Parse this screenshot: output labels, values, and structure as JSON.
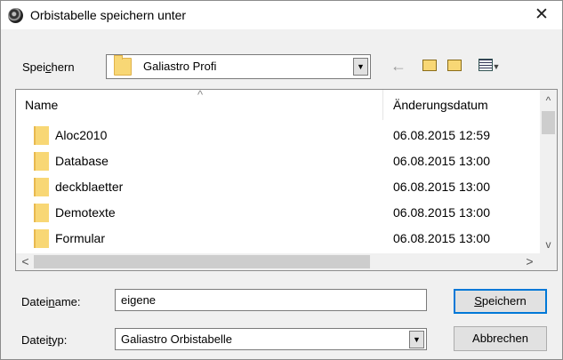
{
  "window": {
    "title": "Orbistabelle speichern unter",
    "close_label": "✕"
  },
  "savein": {
    "label_pre": "Spei",
    "label_u": "c",
    "label_post": "hern",
    "value": "Galiastro Profi"
  },
  "toolbar": {
    "back": "←"
  },
  "list": {
    "headers": {
      "name": "Name",
      "date": "Änderungsdatum",
      "sort_caret": "^"
    },
    "rows": [
      {
        "name": "Aloc2010",
        "date": "06.08.2015 12:59"
      },
      {
        "name": "Database",
        "date": "06.08.2015 13:00"
      },
      {
        "name": "deckblaetter",
        "date": "06.08.2015 13:00"
      },
      {
        "name": "Demotexte",
        "date": "06.08.2015 13:00"
      },
      {
        "name": "Formular",
        "date": "06.08.2015 13:00"
      }
    ],
    "scroll": {
      "up": "^",
      "down": "v",
      "left": "<",
      "right": ">"
    }
  },
  "filename": {
    "label_pre": "Datei",
    "label_u": "n",
    "label_post": "ame:",
    "value": "eigene"
  },
  "filetype": {
    "label_pre": "Datei",
    "label_u": "t",
    "label_post": "yp:",
    "value": "Galiastro Orbistabelle"
  },
  "buttons": {
    "save_u": "S",
    "save_rest": "peichern",
    "cancel": "Abbrechen"
  }
}
